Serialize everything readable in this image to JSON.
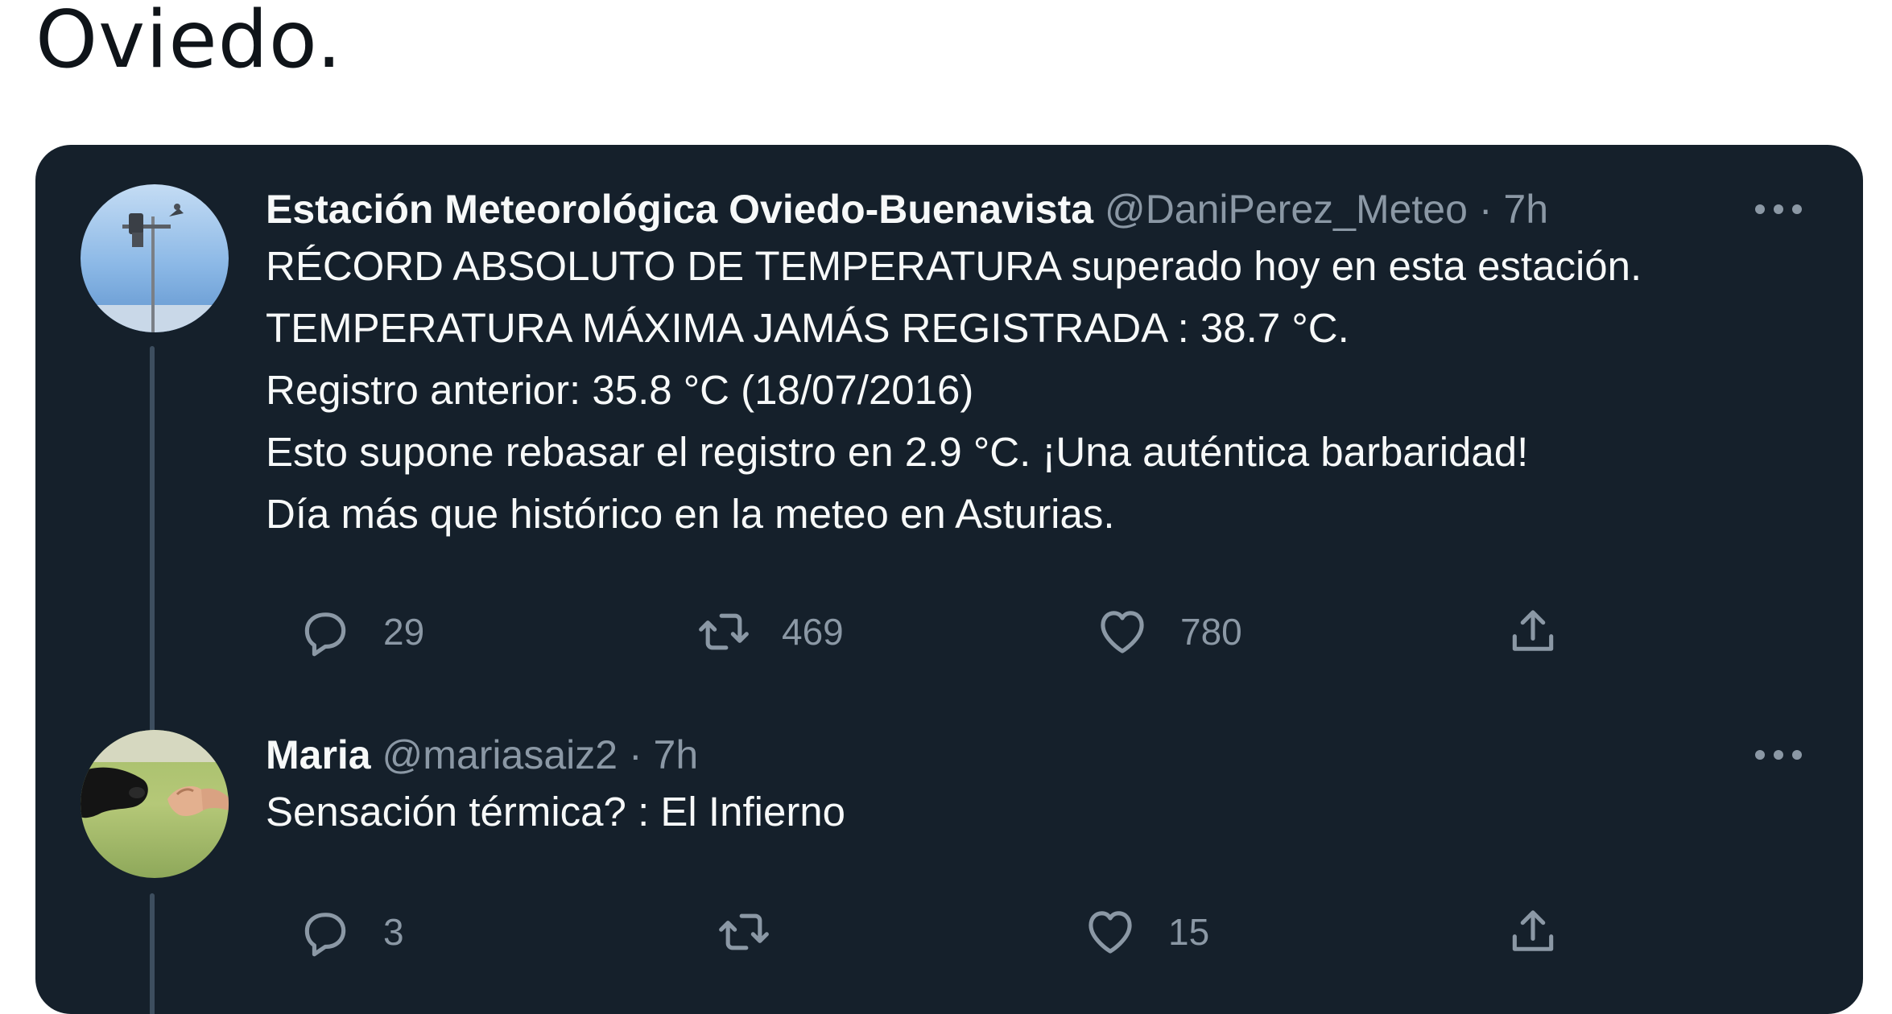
{
  "caption": "Oviedo.",
  "tweets": [
    {
      "name": "Estación Meteorológica Oviedo-Buenavista",
      "handle": "@DaniPerez_Meteo",
      "separator": "·",
      "time": "7h",
      "lines": [
        "RÉCORD ABSOLUTO DE TEMPERATURA superado hoy en esta estación.",
        "TEMPERATURA MÁXIMA JAMÁS REGISTRADA : 38.7 °C.",
        "Registro anterior: 35.8 °C (18/07/2016)",
        "Esto supone rebasar el registro en 2.9 °C. ¡Una auténtica barbaridad!",
        "Día más que histórico en la meteo en Asturias."
      ],
      "replies": "29",
      "retweets": "469",
      "likes": "780",
      "avatar_icon": "weather-station-avatar"
    },
    {
      "name": "Maria",
      "handle": "@mariasaiz2",
      "separator": "·",
      "time": "7h",
      "lines": [
        "Sensación térmica? : El Infierno"
      ],
      "replies": "3",
      "retweets": "",
      "likes": "15",
      "avatar_icon": "cow-and-hand-avatar"
    }
  ],
  "icons": {
    "reply": "reply-icon",
    "retweet": "retweet-icon",
    "like": "heart-icon",
    "share": "share-icon",
    "more": "more-options-icon"
  },
  "colors": {
    "card_bg": "#15202b",
    "text_primary": "#f7f9f9",
    "text_secondary": "#8b98a5",
    "caption_text": "#0f1419"
  }
}
